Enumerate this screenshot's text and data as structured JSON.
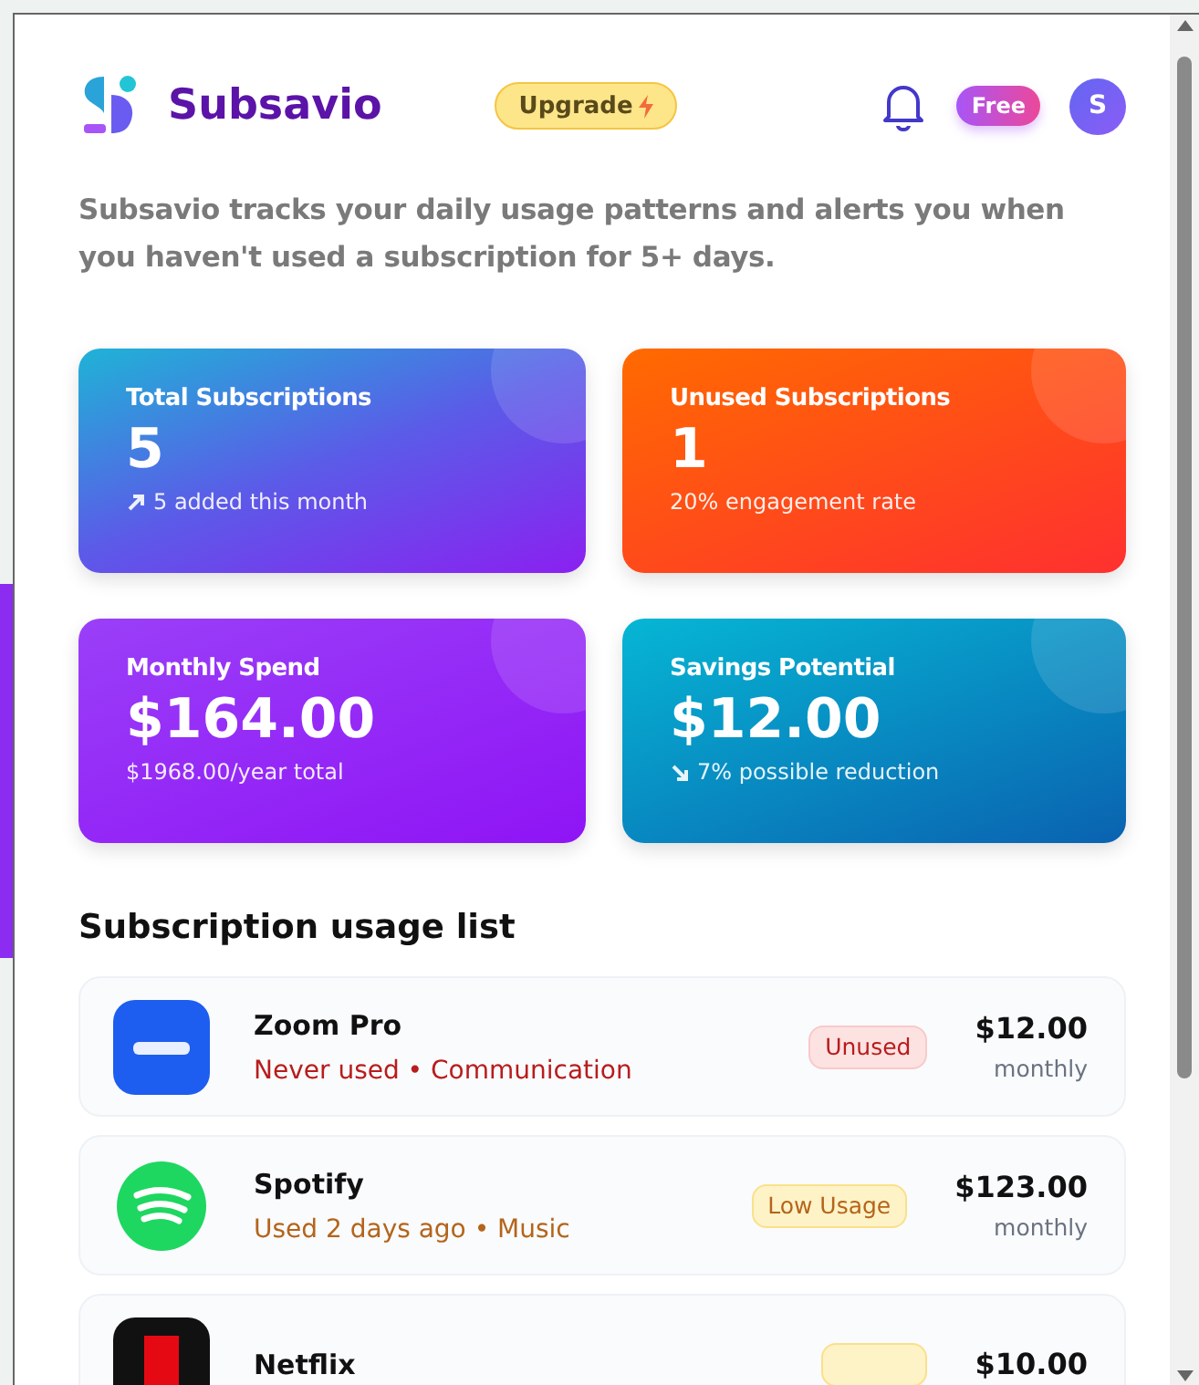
{
  "header": {
    "brand": "Subsavio",
    "upgrade": "Upgrade",
    "plan": "Free",
    "avatar": "S"
  },
  "description": "Subsavio tracks your daily usage patterns and alerts you when you haven't used a subscription for 5+ days.",
  "stats": [
    {
      "kind": "up",
      "title": "Total Subscriptions",
      "value": "5",
      "note": "5 added this month"
    },
    {
      "kind": "plain",
      "title": "Unused Subscriptions",
      "value": "1",
      "note": "20% engagement rate"
    },
    {
      "kind": "plain",
      "title": "Monthly Spend",
      "value": "$164.00",
      "note": "$1968.00/year total"
    },
    {
      "kind": "down",
      "title": "Savings Potential",
      "value": "$12.00",
      "note": "7% possible reduction"
    }
  ],
  "list_title": "Subscription usage list",
  "subscriptions": [
    {
      "kind": "zoom",
      "name": "Zoom Pro",
      "meta": "Never used • Communication",
      "badge": {
        "kind": "unused",
        "label": "Unused"
      },
      "price": "$12.00",
      "period": "monthly"
    },
    {
      "kind": "spotify",
      "name": "Spotify",
      "meta": "Used 2 days ago • Music",
      "badge": {
        "kind": "low",
        "label": "Low Usage"
      },
      "price": "$123.00",
      "period": "monthly"
    },
    {
      "kind": "netflix",
      "name": "Netflix",
      "badge": {
        "kind": "low"
      },
      "price": "$10.00"
    }
  ]
}
